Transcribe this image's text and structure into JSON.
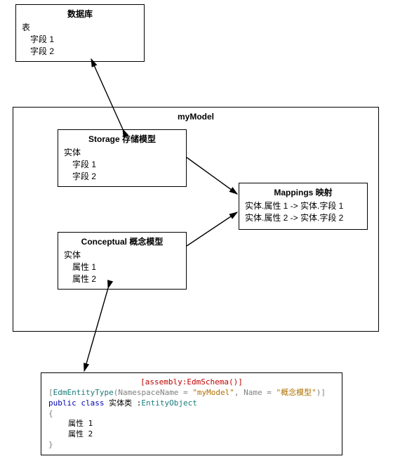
{
  "db": {
    "title": "数据库",
    "table": "表",
    "field1": "字段 1",
    "field2": "字段 2"
  },
  "model": {
    "title": "myModel"
  },
  "storage": {
    "title": "Storage  存储模型",
    "entity": "实体",
    "field1": "字段 1",
    "field2": "字段 2"
  },
  "mappings": {
    "title": "Mappings  映射",
    "line1": "实体.属性 1 -> 实体.字段 1",
    "line2": "实体.属性 2 -> 实体.字段 2"
  },
  "conceptual": {
    "title": "Conceptual  概念模型",
    "entity": "实体",
    "prop1": "属性 1",
    "prop2": "属性 2"
  },
  "code": {
    "line1": "[assembly:EdmSchema()]",
    "attr_open": "[",
    "attr_type": "EdmEntityType",
    "attr_p1k": "(NamespaceName = ",
    "attr_p1v": "\"myModel\"",
    "attr_sep": ", Name = ",
    "attr_p2v": "\"概念模型\"",
    "attr_close": ")]",
    "cls_kw1": "public ",
    "cls_kw2": "class ",
    "cls_name": "实体类 ",
    "cls_colon": ":",
    "cls_base": "EntityObject",
    "brace_o": "{",
    "body1": "属性 1",
    "body2": "属性 2",
    "brace_c": "}"
  }
}
